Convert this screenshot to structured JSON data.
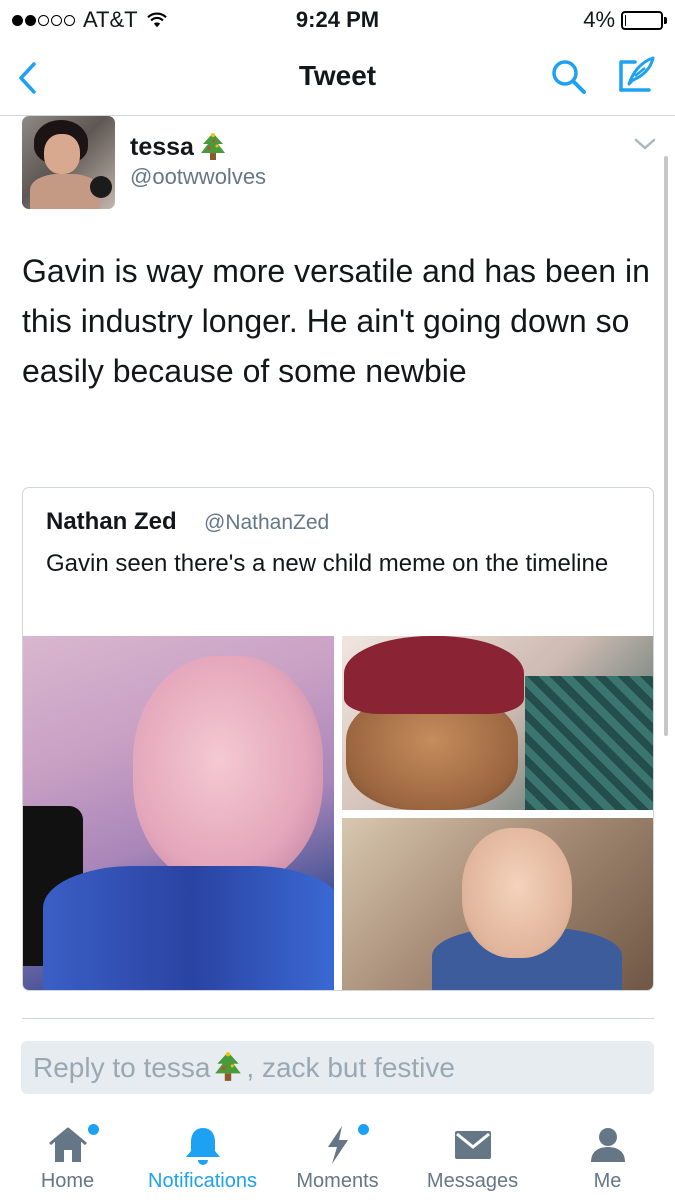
{
  "status_bar": {
    "carrier": "AT&T",
    "time": "9:24 PM",
    "battery": "4%",
    "battery_level": 0.04
  },
  "nav": {
    "title": "Tweet"
  },
  "tweet": {
    "author_name": "tessa",
    "author_handle": "@ootwwolves",
    "text": "Gavin is way more versatile and has been in this industry longer. He ain't going down so easily because of some newbie",
    "quote": {
      "name": "Nathan Zed",
      "handle": "@NathanZed",
      "text": "Gavin seen there's a new child meme on the timeline"
    }
  },
  "reply": {
    "prefix": "Reply to tessa",
    "suffix": ", zack but festive"
  },
  "tabs": [
    {
      "label": "Home",
      "icon": "home-icon",
      "active": false,
      "badge": true
    },
    {
      "label": "Notifications",
      "icon": "bell-icon",
      "active": true,
      "badge": true
    },
    {
      "label": "Moments",
      "icon": "lightning-icon",
      "active": false,
      "badge": false
    },
    {
      "label": "Messages",
      "icon": "envelope-icon",
      "active": false,
      "badge": false
    },
    {
      "label": "Me",
      "icon": "person-icon",
      "active": false,
      "badge": false
    }
  ],
  "colors": {
    "accent": "#1da1f2",
    "text": "#14171a",
    "secondary": "#657786",
    "tree": "#4a9a3a"
  }
}
